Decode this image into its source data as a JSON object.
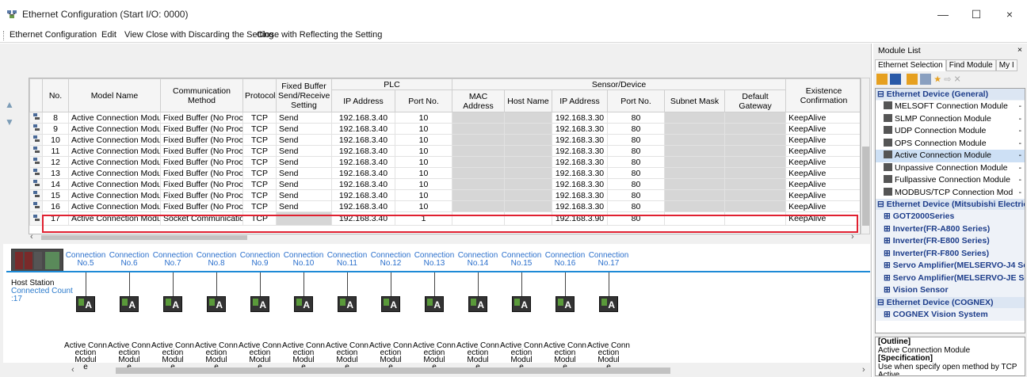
{
  "window": {
    "title": "Ethernet Configuration (Start I/O: 0000)",
    "minimize_glyph": "—",
    "maximize_glyph": "☐",
    "close_glyph": "×"
  },
  "menu": [
    "Ethernet Configuration",
    "Edit",
    "View",
    "Close with Discarding the Setting",
    "Close with Reflecting the Setting"
  ],
  "table": {
    "group_plc": "PLC",
    "group_sensor": "Sensor/Device",
    "headers": {
      "no": "No.",
      "model": "Model Name",
      "method": "Communication Method",
      "protocol": "Protocol",
      "fixed": "Fixed Buffer Send/Receive Setting",
      "plc_ip": "IP Address",
      "plc_port": "Port No.",
      "mac": "MAC Address",
      "host": "Host Name",
      "dev_ip": "IP Address",
      "dev_port": "Port No.",
      "subnet": "Subnet Mask",
      "gateway": "Default Gateway",
      "existence": "Existence Confirmation"
    },
    "rows": [
      {
        "no": "8",
        "model": "Active Connection Module",
        "method": "Fixed Buffer (No Proced",
        "protocol": "TCP",
        "fixed": "Send",
        "plc_ip": "192.168.3.40",
        "plc_port": "10",
        "dev_ip": "192.168.3.30",
        "dev_port": "80",
        "existence": "KeepAlive"
      },
      {
        "no": "9",
        "model": "Active Connection Module",
        "method": "Fixed Buffer (No Proced",
        "protocol": "TCP",
        "fixed": "Send",
        "plc_ip": "192.168.3.40",
        "plc_port": "10",
        "dev_ip": "192.168.3.30",
        "dev_port": "80",
        "existence": "KeepAlive"
      },
      {
        "no": "10",
        "model": "Active Connection Module",
        "method": "Fixed Buffer (No Proced",
        "protocol": "TCP",
        "fixed": "Send",
        "plc_ip": "192.168.3.40",
        "plc_port": "10",
        "dev_ip": "192.168.3.30",
        "dev_port": "80",
        "existence": "KeepAlive"
      },
      {
        "no": "11",
        "model": "Active Connection Module",
        "method": "Fixed Buffer (No Proced",
        "protocol": "TCP",
        "fixed": "Send",
        "plc_ip": "192.168.3.40",
        "plc_port": "10",
        "dev_ip": "192.168.3.30",
        "dev_port": "80",
        "existence": "KeepAlive"
      },
      {
        "no": "12",
        "model": "Active Connection Module",
        "method": "Fixed Buffer (No Proced",
        "protocol": "TCP",
        "fixed": "Send",
        "plc_ip": "192.168.3.40",
        "plc_port": "10",
        "dev_ip": "192.168.3.30",
        "dev_port": "80",
        "existence": "KeepAlive"
      },
      {
        "no": "13",
        "model": "Active Connection Module",
        "method": "Fixed Buffer (No Proced",
        "protocol": "TCP",
        "fixed": "Send",
        "plc_ip": "192.168.3.40",
        "plc_port": "10",
        "dev_ip": "192.168.3.30",
        "dev_port": "80",
        "existence": "KeepAlive"
      },
      {
        "no": "14",
        "model": "Active Connection Module",
        "method": "Fixed Buffer (No Proced",
        "protocol": "TCP",
        "fixed": "Send",
        "plc_ip": "192.168.3.40",
        "plc_port": "10",
        "dev_ip": "192.168.3.30",
        "dev_port": "80",
        "existence": "KeepAlive"
      },
      {
        "no": "15",
        "model": "Active Connection Module",
        "method": "Fixed Buffer (No Proced",
        "protocol": "TCP",
        "fixed": "Send",
        "plc_ip": "192.168.3.40",
        "plc_port": "10",
        "dev_ip": "192.168.3.30",
        "dev_port": "80",
        "existence": "KeepAlive"
      },
      {
        "no": "16",
        "model": "Active Connection Module",
        "method": "Fixed Buffer (No Proced",
        "protocol": "TCP",
        "fixed": "Send",
        "plc_ip": "192.168.3.40",
        "plc_port": "10",
        "dev_ip": "192.168.3.30",
        "dev_port": "80",
        "existence": "KeepAlive"
      },
      {
        "no": "17",
        "model": "Active Connection Module",
        "method": "Socket Communication",
        "protocol": "TCP",
        "fixed": "",
        "plc_ip": "192.168.3.40",
        "plc_port": "1",
        "dev_ip": "192.168.3.90",
        "dev_port": "80",
        "existence": "KeepAlive"
      }
    ],
    "highlight_color": "#e02030"
  },
  "diagram": {
    "host_label": "Host Station",
    "host_sub": "Connected Count",
    "host_count": ":17",
    "bus_color": "#1e8ad6",
    "connections": [
      {
        "l1": "Connection",
        "l2": "No.5"
      },
      {
        "l1": "Connection",
        "l2": "No.6"
      },
      {
        "l1": "Connection",
        "l2": "No.7"
      },
      {
        "l1": "Connection",
        "l2": "No.8"
      },
      {
        "l1": "Connection",
        "l2": "No.9"
      },
      {
        "l1": "Connection",
        "l2": "No.10"
      },
      {
        "l1": "Connection",
        "l2": "No.11"
      },
      {
        "l1": "Connection",
        "l2": "No.12"
      },
      {
        "l1": "Connection",
        "l2": "No.13"
      },
      {
        "l1": "Connection",
        "l2": "No.14"
      },
      {
        "l1": "Connection",
        "l2": "No.15"
      },
      {
        "l1": "Connection",
        "l2": "No.16"
      },
      {
        "l1": "Connection",
        "l2": "No.17"
      }
    ],
    "module_glyph": "A",
    "module_label_lines": [
      "Active Conn",
      "ection Modul",
      "e"
    ]
  },
  "module_list": {
    "title": "Module List",
    "tabs": [
      "Ethernet Selection",
      "Find Module",
      "My I"
    ],
    "cat_general": "Ethernet Device (General)",
    "general_items": [
      "MELSOFT Connection Module",
      "SLMP Connection Module",
      "UDP Connection Module",
      "OPS Connection Module",
      "Active Connection Module",
      "Unpassive Connection Module",
      "Fullpassive Connection Module",
      "MODBUS/TCP Connection Mod"
    ],
    "cat_mitsubishi": "Ethernet Device (Mitsubishi Electric",
    "mitsubishi_items": [
      "GOT2000Series",
      "Inverter(FR-A800 Series)",
      "Inverter(FR-E800 Series)",
      "Inverter(FR-F800 Series)",
      "Servo Amplifier(MELSERVO-J4 Se",
      "Servo Amplifier(MELSERVO-JE Se",
      "Vision Sensor"
    ],
    "cat_cognex": "Ethernet Device (COGNEX)",
    "cognex_items": [
      "COGNEX Vision System"
    ],
    "outline_head": "[Outline]",
    "outline_text": "Active Connection Module",
    "spec_head": "[Specification]",
    "spec_text": "Use when specify open method by TCP Active"
  }
}
